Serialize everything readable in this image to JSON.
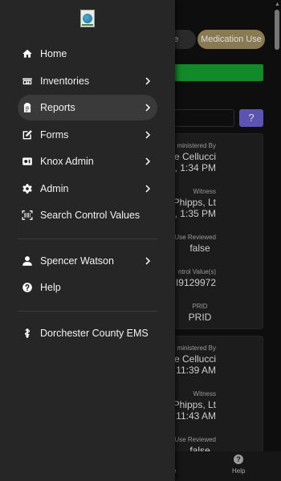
{
  "background": {
    "chip_left_label": "ge",
    "chip_medication_label": "Medication Use",
    "question_button": "?",
    "card1": {
      "administered_by_label": "ministered By",
      "administered_by_name": "e Cellucci",
      "administered_by_time": "6, 1:34 PM",
      "witness_label": "Witness",
      "witness_name": "f Phipps, Lt",
      "witness_time": "6, 1:35 PM",
      "use_reviewed_label": "Use Reviewed",
      "use_reviewed_value": "false",
      "control_values_label": "ntrol Value(s)",
      "control_values_value": "CI9129972",
      "prid_label": "PRID",
      "prid_value": "PRID"
    },
    "card2": {
      "administered_by_label": "ministered By",
      "administered_by_name": "e Cellucci",
      "administered_by_time": "5, 11:39 AM",
      "witness_label": "Witness",
      "witness_name": "f Phipps, Lt",
      "witness_time": "5, 11:43 AM",
      "use_reviewed_label": "Use Reviewed",
      "use_reviewed_value": "false"
    },
    "bottom_nav": {
      "partial_label": "e",
      "help_label": "Help",
      "help_icon_glyph": "?"
    }
  },
  "drawer": {
    "logo_icon": "agency-logo-icon",
    "items": [
      {
        "label": "Home",
        "icon": "home-icon",
        "chevron": false
      },
      {
        "label": "Inventories",
        "icon": "inventory-icon",
        "chevron": true
      },
      {
        "label": "Reports",
        "icon": "clipboard-icon",
        "chevron": true,
        "active": true
      },
      {
        "label": "Forms",
        "icon": "edit-icon",
        "chevron": true
      },
      {
        "label": "Knox Admin",
        "icon": "knox-icon",
        "chevron": true
      },
      {
        "label": "Admin",
        "icon": "gear-icon",
        "chevron": true
      },
      {
        "label": "Search Control Values",
        "icon": "barcode-scan-icon",
        "chevron": false
      }
    ],
    "user": {
      "label": "Spencer Watson",
      "icon": "person-icon",
      "chevron": true
    },
    "help": {
      "label": "Help",
      "icon": "help-circle-icon",
      "chevron": false
    },
    "agency": {
      "label": "Dorchester County EMS",
      "icon": "ems-icon",
      "chevron": false
    }
  },
  "colors": {
    "drawer_bg": "#262626",
    "active_item_bg": "#3a3a3a",
    "medication_chip": "#8a7a52",
    "green_bar": "#138a2a",
    "purple_button": "#5a55b0"
  }
}
